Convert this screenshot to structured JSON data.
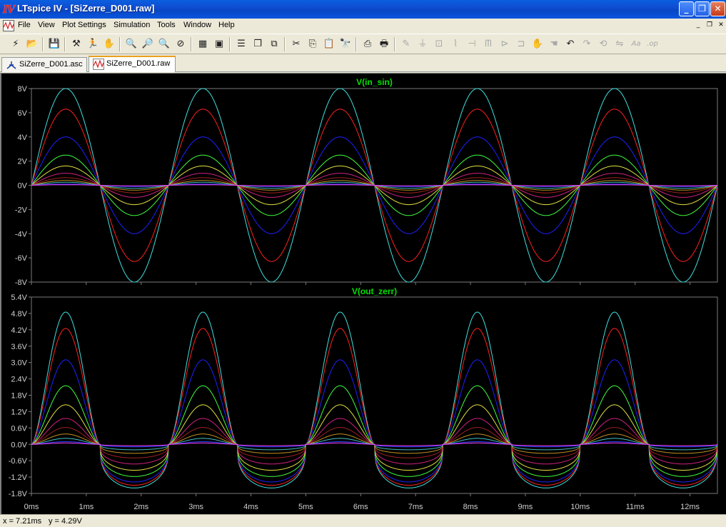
{
  "window": {
    "title": "LTspice IV - [SiZerre_D001.raw]",
    "app_icon": "ltspice-logo-icon",
    "minimize_glyph": "_",
    "maximize_glyph": "❐",
    "close_glyph": "✕"
  },
  "menubar": {
    "items": [
      "File",
      "View",
      "Plot Settings",
      "Simulation",
      "Tools",
      "Window",
      "Help"
    ],
    "mdi_minimize": "_",
    "mdi_restore": "❐",
    "mdi_close": "✕"
  },
  "toolbar": {
    "buttons": [
      {
        "name": "new-schematic-icon",
        "glyph": "⚡",
        "enabled": true
      },
      {
        "name": "open-icon",
        "glyph": "📂",
        "enabled": true
      },
      {
        "name": "save-icon",
        "glyph": "💾",
        "enabled": true
      },
      {
        "name": "control-panel-icon",
        "glyph": "⚒",
        "enabled": true
      },
      {
        "name": "run-icon",
        "glyph": "🏃",
        "enabled": true
      },
      {
        "name": "halt-icon",
        "glyph": "✋",
        "enabled": false
      },
      {
        "name": "zoom-in-icon",
        "glyph": "🔍",
        "enabled": true
      },
      {
        "name": "zoom-pan-icon",
        "glyph": "🔎",
        "enabled": true
      },
      {
        "name": "zoom-out-icon",
        "glyph": "🔍",
        "enabled": true
      },
      {
        "name": "zoom-fit-icon",
        "glyph": "⊘",
        "enabled": true
      },
      {
        "name": "autorange-icon",
        "glyph": "▦",
        "enabled": true
      },
      {
        "name": "pick-visible-icon",
        "glyph": "▣",
        "enabled": true
      },
      {
        "name": "tile-horizontal-icon",
        "glyph": "☰",
        "enabled": true
      },
      {
        "name": "cascade-icon",
        "glyph": "❐",
        "enabled": true
      },
      {
        "name": "tile-vertical-icon",
        "glyph": "⧉",
        "enabled": true
      },
      {
        "name": "cut-icon",
        "glyph": "✂",
        "enabled": true
      },
      {
        "name": "copy-icon",
        "glyph": "⎘",
        "enabled": true
      },
      {
        "name": "paste-icon",
        "glyph": "📋",
        "enabled": true
      },
      {
        "name": "find-icon",
        "glyph": "🔭",
        "enabled": true
      },
      {
        "name": "print-setup-icon",
        "glyph": "⎙",
        "enabled": true
      },
      {
        "name": "print-icon",
        "glyph": "🖶",
        "enabled": true
      },
      {
        "name": "wire-icon",
        "glyph": "✎",
        "enabled": false
      },
      {
        "name": "ground-icon",
        "glyph": "⏚",
        "enabled": false
      },
      {
        "name": "label-net-icon",
        "glyph": "⊡",
        "enabled": false
      },
      {
        "name": "resistor-icon",
        "glyph": "⌇",
        "enabled": false
      },
      {
        "name": "capacitor-icon",
        "glyph": "⊣",
        "enabled": false
      },
      {
        "name": "inductor-icon",
        "glyph": "ᗰ",
        "enabled": false
      },
      {
        "name": "diode-icon",
        "glyph": "⊳",
        "enabled": false
      },
      {
        "name": "component-icon",
        "glyph": "⊐",
        "enabled": false
      },
      {
        "name": "move-hand-icon",
        "glyph": "✋",
        "enabled": false
      },
      {
        "name": "drag-hand-icon",
        "glyph": "☚",
        "enabled": false
      },
      {
        "name": "undo-icon",
        "glyph": "↶",
        "enabled": true
      },
      {
        "name": "redo-icon",
        "glyph": "↷",
        "enabled": false
      },
      {
        "name": "rotate-icon",
        "glyph": "⟲",
        "enabled": false
      },
      {
        "name": "mirror-icon",
        "glyph": "⇋",
        "enabled": false
      },
      {
        "name": "text-icon",
        "glyph": "Aa",
        "enabled": false
      },
      {
        "name": "spice-directive-icon",
        "glyph": ".op",
        "enabled": false
      }
    ]
  },
  "tabs": [
    {
      "label": "SiZerre_D001.asc",
      "icon": "schematic-icon",
      "active": false
    },
    {
      "label": "SiZerre_D001.raw",
      "icon": "waveform-icon",
      "active": true
    }
  ],
  "plot": {
    "background": "#000000",
    "grid_color": "#7a7a7a",
    "axis_text_color": "#d0d0d0",
    "trace_title_color": "#00e000"
  },
  "chart_data": [
    {
      "type": "line",
      "title": "V(in_sin)",
      "x": {
        "label": "",
        "lim": [
          0,
          12.5
        ],
        "ticks": [
          0,
          1,
          2,
          3,
          4,
          5,
          6,
          7,
          8,
          9,
          10,
          11,
          12
        ],
        "tick_labels": [
          "0ms",
          "1ms",
          "2ms",
          "3ms",
          "4ms",
          "5ms",
          "6ms",
          "7ms",
          "8ms",
          "9ms",
          "10ms",
          "11ms",
          "12ms"
        ]
      },
      "y": {
        "label": "",
        "lim": [
          -8,
          8
        ],
        "ticks": [
          8,
          6,
          4,
          2,
          0,
          -2,
          -4,
          -6,
          -8
        ],
        "tick_labels": [
          "8V",
          "6V",
          "4V",
          "2V",
          "0V",
          "-2V",
          "-4V",
          "-6V",
          "-8V"
        ]
      },
      "period_ms": 2.5,
      "waveform": "sine",
      "series": [
        {
          "color": "#40e0e0",
          "amplitude": 8.0
        },
        {
          "color": "#ff2020",
          "amplitude": 6.3
        },
        {
          "color": "#2020ff",
          "amplitude": 4.0
        },
        {
          "color": "#40ff40",
          "amplitude": 2.5
        },
        {
          "color": "#e0e040",
          "amplitude": 1.6
        },
        {
          "color": "#d02080",
          "amplitude": 1.0
        },
        {
          "color": "#a02020",
          "amplitude": 0.63
        },
        {
          "color": "#c09020",
          "amplitude": 0.4
        },
        {
          "color": "#40c0c0",
          "amplitude": 0.25
        },
        {
          "color": "#2040ff",
          "amplitude": 0.1
        },
        {
          "color": "#ff40ff",
          "amplitude": 0.05
        }
      ]
    },
    {
      "type": "line",
      "title": "V(out_zerr)",
      "x": {
        "label": "",
        "lim": [
          0,
          12.5
        ],
        "ticks": [
          0,
          1,
          2,
          3,
          4,
          5,
          6,
          7,
          8,
          9,
          10,
          11,
          12
        ],
        "tick_labels": [
          "0ms",
          "1ms",
          "2ms",
          "3ms",
          "4ms",
          "5ms",
          "6ms",
          "7ms",
          "8ms",
          "9ms",
          "10ms",
          "11ms",
          "12ms"
        ]
      },
      "y": {
        "label": "",
        "lim": [
          -1.8,
          5.4
        ],
        "ticks": [
          5.4,
          4.8,
          4.2,
          3.6,
          3.0,
          2.4,
          1.8,
          1.2,
          0.6,
          0.0,
          -0.6,
          -1.2,
          -1.8
        ],
        "tick_labels": [
          "5.4V",
          "4.8V",
          "4.2V",
          "3.6V",
          "3.0V",
          "2.4V",
          "1.8V",
          "1.2V",
          "0.6V",
          "0.0V",
          "-0.6V",
          "-1.2V",
          "-1.8V"
        ]
      },
      "period_ms": 2.5,
      "waveform": "zener-clipped-sine",
      "series": [
        {
          "color": "#40e0e0",
          "positive_peak": 4.85,
          "negative_peak": -1.6
        },
        {
          "color": "#ff2020",
          "positive_peak": 4.25,
          "negative_peak": -1.5
        },
        {
          "color": "#2020ff",
          "positive_peak": 3.1,
          "negative_peak": -1.38
        },
        {
          "color": "#40ff40",
          "positive_peak": 2.15,
          "negative_peak": -1.18
        },
        {
          "color": "#e0e040",
          "positive_peak": 1.45,
          "negative_peak": -0.95
        },
        {
          "color": "#d02080",
          "positive_peak": 0.95,
          "negative_peak": -0.72
        },
        {
          "color": "#a02020",
          "positive_peak": 0.62,
          "negative_peak": -0.5
        },
        {
          "color": "#c09020",
          "positive_peak": 0.38,
          "negative_peak": -0.33
        },
        {
          "color": "#40c0c0",
          "positive_peak": 0.22,
          "negative_peak": -0.2
        },
        {
          "color": "#2040ff",
          "positive_peak": 0.1,
          "negative_peak": -0.09
        },
        {
          "color": "#ff40ff",
          "positive_peak": 0.05,
          "negative_peak": -0.05
        }
      ]
    }
  ],
  "statusbar": {
    "x_readout": "x = 7.21ms",
    "y_readout": "y = 4.29V"
  }
}
